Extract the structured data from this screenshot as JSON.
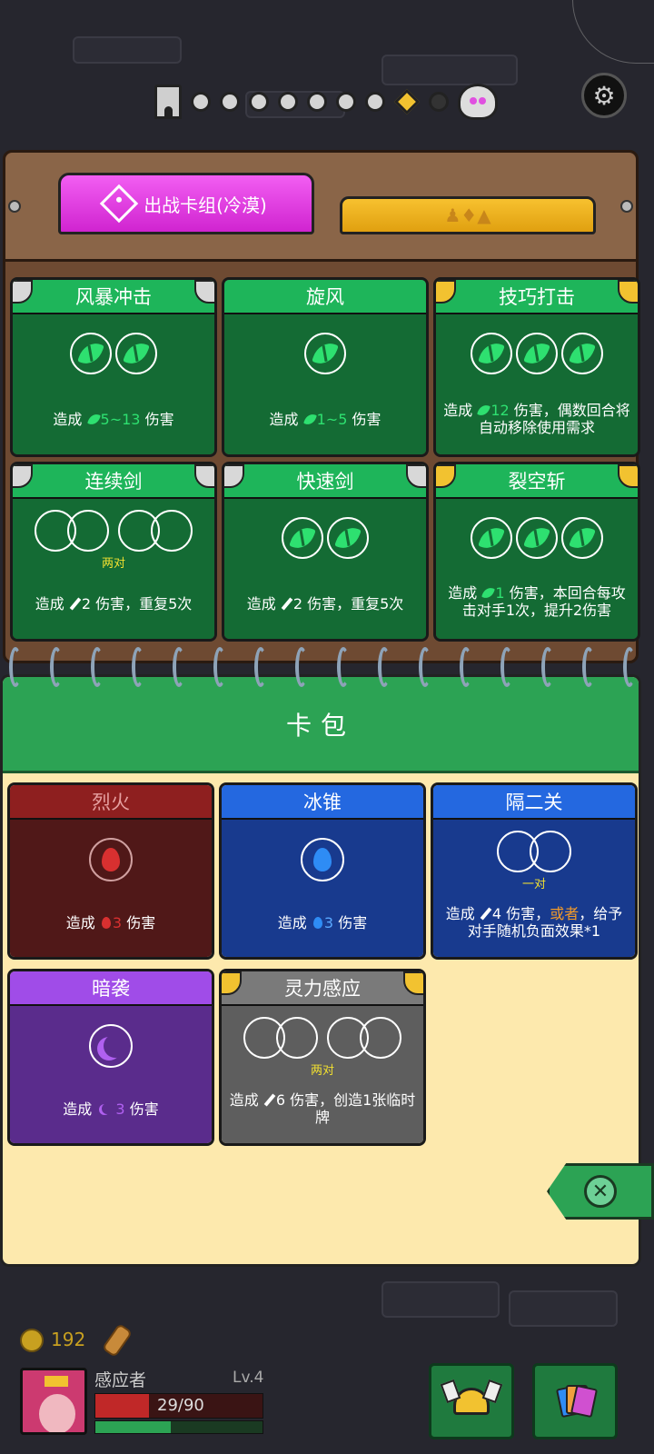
{
  "deck_tabs": {
    "active_label": "出战卡组(冷漠)",
    "inactive_icons": "♟♦▲"
  },
  "deck_cards": [
    {
      "title": "风暴冲击",
      "desc_prefix": "造成",
      "damage": "5~13",
      "desc_suffix": "伤害"
    },
    {
      "title": "旋风",
      "desc_prefix": "造成",
      "damage": "1~5",
      "desc_suffix": "伤害"
    },
    {
      "title": "技巧打击",
      "desc_prefix": "造成",
      "damage": "12",
      "desc_suffix": "伤害，偶数回合将自动移除使用需求"
    },
    {
      "title": "连续剑",
      "pair_label": "两对",
      "desc_prefix": "造成",
      "damage": "2",
      "desc_suffix": "伤害，重复5次"
    },
    {
      "title": "快速剑",
      "desc_prefix": "造成",
      "damage": "2",
      "desc_suffix": "伤害，重复5次"
    },
    {
      "title": "裂空斩",
      "desc_prefix": "造成",
      "damage": "1",
      "desc_suffix": "伤害，本回合每攻击对手1次，提升2伤害"
    }
  ],
  "pack": {
    "header": "卡包",
    "cards": [
      {
        "title": "烈火",
        "desc_prefix": "造成",
        "damage": "3",
        "desc_suffix": "伤害"
      },
      {
        "title": "冰锥",
        "desc_prefix": "造成",
        "damage": "3",
        "desc_suffix": "伤害"
      },
      {
        "title": "隔二关",
        "pair_label": "一对",
        "desc_prefix": "造成",
        "damage": "4",
        "desc_mid": "伤害，",
        "desc_or": "或者",
        "desc_suffix": "，给予对手随机负面效果*1"
      },
      {
        "title": "暗袭",
        "desc_prefix": "造成",
        "damage": "3",
        "desc_suffix": "伤害"
      },
      {
        "title": "灵力感应",
        "pair_label": "两对",
        "desc_prefix": "造成",
        "damage": "6",
        "desc_suffix": "伤害，创造1张临时牌"
      }
    ]
  },
  "hud": {
    "gold": "192",
    "hero_name": "感应者",
    "level": "Lv.4",
    "hp_text": "29/90",
    "hp_fraction": 0.32,
    "xp_fraction": 0.45
  },
  "icons": {
    "close": "✕",
    "gear": "⚙"
  }
}
